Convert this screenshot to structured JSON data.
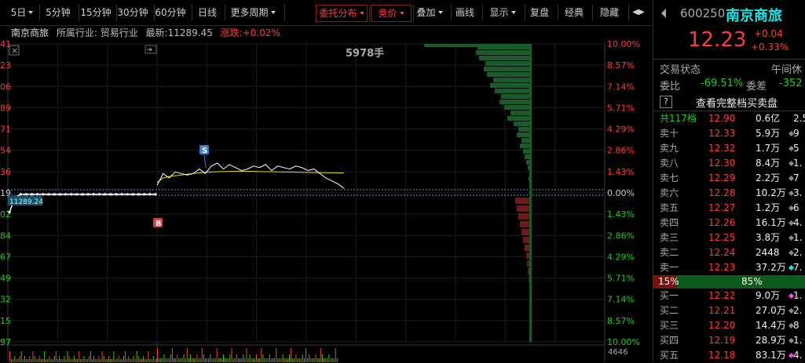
{
  "toolbar": {
    "items": [
      {
        "label": "5日",
        "caret": true,
        "red": false
      },
      {
        "label": "5分钟",
        "caret": false,
        "red": false
      },
      {
        "label": "15分钟",
        "caret": false,
        "red": false
      },
      {
        "label": "30分钟",
        "caret": false,
        "red": false
      },
      {
        "label": "60分钟",
        "caret": false,
        "red": false
      },
      {
        "label": "日线",
        "caret": false,
        "red": false
      },
      {
        "label": "更多周期",
        "caret": true,
        "red": false
      },
      {
        "label": "委托分布",
        "caret": true,
        "red": true
      },
      {
        "label": "竞价",
        "caret": true,
        "red": true
      },
      {
        "label": "叠加",
        "caret": true,
        "red": false
      },
      {
        "label": "画线",
        "caret": false,
        "red": false
      },
      {
        "label": "显示",
        "caret": true,
        "red": false
      },
      {
        "label": "复盘",
        "caret": false,
        "red": false
      },
      {
        "label": "经典",
        "caret": false,
        "red": false
      },
      {
        "label": "隐藏",
        "caret": false,
        "red": false
      }
    ],
    "scroll_label": "◀▶"
  },
  "info": {
    "stock_name": "南京商旅",
    "industry": "所属行业: 贸易行业",
    "latest": "最新:11289.45",
    "change": "涨跌:+0.02%"
  },
  "chart_data": {
    "type": "line",
    "title": "",
    "volume_label": "5978手",
    "right_axis_pct": [
      "10.00%",
      "8.57%",
      "7.14%",
      "5.71%",
      "4.29%",
      "2.86%",
      "1.43%",
      "0.00%",
      "1.43%",
      "2.86%",
      "4.29%",
      "5.71%",
      "7.14%",
      "8.57%",
      "10.00%"
    ],
    "left_axis_partial": [
      "41",
      "23",
      "06",
      "89",
      "71",
      "54",
      "36",
      "19",
      "02",
      "84",
      "67",
      "49",
      "32",
      "15",
      "97"
    ],
    "pct_range": [
      -10,
      10
    ],
    "price_points_segment1": [
      -1.3,
      -0.3,
      -0.1,
      -0.1,
      -0.1,
      -0.1,
      -0.1,
      -0.1,
      -0.1,
      -0.1,
      -0.1,
      -0.1,
      -0.1,
      -0.1,
      -0.1,
      -0.1,
      -0.1,
      -0.1,
      -0.1,
      -0.1,
      -0.1,
      -0.1,
      -0.1,
      -0.1,
      -0.1,
      -0.1,
      -0.1
    ],
    "price_points_segment2": [
      0.5,
      1.3,
      1.0,
      1.4,
      1.3,
      1.2,
      1.3,
      1.6,
      1.3,
      1.8,
      2.0,
      1.6,
      1.9,
      1.7,
      1.5,
      1.6,
      1.8,
      1.7,
      1.9,
      1.5,
      1.8,
      1.7,
      1.6,
      1.8,
      1.7,
      1.5,
      1.6,
      1.3,
      1.0,
      0.8,
      0.6,
      0.3
    ],
    "avg_points_segment2": [
      0.7,
      1.0,
      1.1,
      1.15,
      1.2,
      1.25,
      1.3,
      1.35,
      1.38,
      1.4,
      1.42,
      1.43,
      1.44,
      1.45,
      1.45,
      1.45,
      1.44,
      1.43,
      1.42,
      1.42,
      1.41,
      1.4,
      1.4,
      1.39,
      1.38,
      1.37,
      1.37,
      1.36,
      1.35,
      1.35,
      1.34,
      1.34
    ],
    "markers": [
      {
        "label": "S",
        "color": "#3b7fd6"
      },
      {
        "label": "B",
        "color": "#d84040"
      }
    ],
    "left_badge": "11289.24",
    "bottom_right_value": "4646",
    "sell_depth_bars": [
      2,
      3,
      2,
      4,
      6,
      8,
      10,
      14,
      12,
      18,
      16,
      22,
      30,
      26,
      34,
      40,
      38,
      46,
      52,
      48,
      56,
      60,
      58,
      66,
      70,
      68
    ],
    "buy_depth_bars": [
      20,
      18,
      16,
      14,
      12,
      10,
      8,
      6,
      5,
      4,
      3,
      2
    ]
  },
  "panel": {
    "code": "600250",
    "name": "南京商旅",
    "price": "12.23",
    "change": "+0.04",
    "change_pct": "+0.33%",
    "status_label": "交易状态",
    "status_value": "午间休",
    "wb_label": "委比",
    "wb_value": "-69.51%",
    "wc_label": "委差",
    "wc_value": "-352",
    "full_book": "查看完整档买卖盘",
    "help": "?",
    "total_label": "共117档",
    "total_price": "12.90",
    "total_vol": "0.6亿",
    "total_extra": "2.5",
    "sells": [
      {
        "label": "卖十",
        "price": "12.33",
        "vol": "5.9万",
        "extra": "9"
      },
      {
        "label": "卖九",
        "price": "12.32",
        "vol": "1.7万",
        "extra": "5"
      },
      {
        "label": "卖八",
        "price": "12.30",
        "vol": "8.4万",
        "extra": "1."
      },
      {
        "label": "卖七",
        "price": "12.29",
        "vol": "2.2万",
        "extra": "7"
      },
      {
        "label": "卖六",
        "price": "12.28",
        "vol": "10.2万",
        "extra": "3."
      },
      {
        "label": "卖五",
        "price": "12.27",
        "vol": "1.2万",
        "extra": "6"
      },
      {
        "label": "卖四",
        "price": "12.26",
        "vol": "16.1万",
        "extra": "4."
      },
      {
        "label": "卖三",
        "price": "12.25",
        "vol": "3.8万",
        "extra": "1."
      },
      {
        "label": "卖二",
        "price": "12.24",
        "vol": "2448",
        "extra": "2."
      },
      {
        "label": "卖一",
        "price": "12.23",
        "vol": "37.2万",
        "extra": "7."
      }
    ],
    "ratio_sell": "15%",
    "ratio_buy": "85%",
    "buys": [
      {
        "label": "买一",
        "price": "12.22",
        "vol": "9.0万",
        "extra": "1."
      },
      {
        "label": "买二",
        "price": "12.21",
        "vol": "27.0万",
        "extra": "2."
      },
      {
        "label": "买三",
        "price": "12.20",
        "vol": "14.4万",
        "extra": "8"
      },
      {
        "label": "买四",
        "price": "12.19",
        "vol": "28.9万",
        "extra": "1."
      },
      {
        "label": "买五",
        "price": "12.18",
        "vol": "83.1万",
        "extra": "4."
      }
    ]
  }
}
